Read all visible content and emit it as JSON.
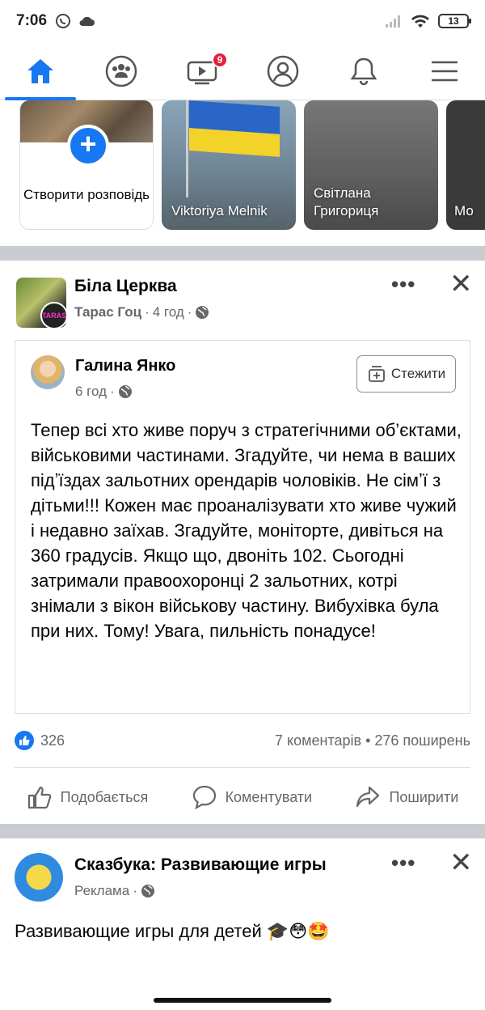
{
  "status_bar": {
    "time": "7:06",
    "battery": "13"
  },
  "nav": {
    "video_badge": "9",
    "items": [
      {
        "name": "home-icon",
        "active": true
      },
      {
        "name": "groups-icon",
        "active": false
      },
      {
        "name": "watch-icon",
        "active": false
      },
      {
        "name": "profile-icon",
        "active": false
      },
      {
        "name": "notifications-icon",
        "active": false
      },
      {
        "name": "menu-icon",
        "active": false
      }
    ]
  },
  "stories": {
    "create_label": "Створити розповідь",
    "items": [
      {
        "name": "Viktoriya Melnik"
      },
      {
        "name": "Світлана Григориця"
      },
      {
        "name": "Мо"
      }
    ]
  },
  "post": {
    "group": "Біла Церква",
    "author": "Тарас Гоц",
    "time": "4 год",
    "shared": {
      "author": "Галина Янко",
      "time": "6 год",
      "follow_label": "Стежити",
      "text": "Тепер всі хто живе поруч з стратегічними об’єктами, військовими частинами. Згадуйте, чи нема в ваших підʼїздах зальотних орендарів чоловіків. Не сімʼї з дітьми!!! Кожен має проаналізувати хто живе чужий і недавно заїхав. Згадуйте, моніторте, дивіться на 360 градусів. Якщо що, двоніть 102. Сьогодні затримали правоохоронці 2 зальотних, котрі знімали з вікон військову частину. Вибухівка була при них. Тому! Увага, пильність понадусе!"
    },
    "reactions_count": "326",
    "comments_shares": "7 коментарів • 276 поширень",
    "actions": {
      "like": "Подобається",
      "comment": "Коментувати",
      "share": "Поширити"
    }
  },
  "ad": {
    "title": "Сказбука: Развивающие игры",
    "label": "Реклама",
    "text": "Развивающие игры для детей 🎓😳🤩"
  },
  "colors": {
    "accent": "#1877f2",
    "badge": "#e41e3f",
    "divider": "#c9ccd1"
  }
}
